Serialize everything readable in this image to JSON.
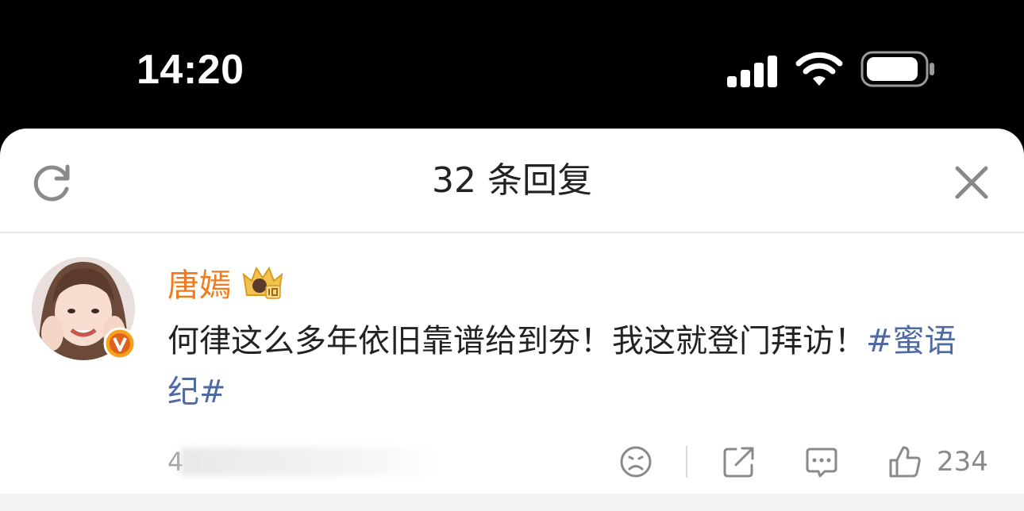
{
  "status_bar": {
    "time": "14:20",
    "icons": [
      "cellular-signal-icon",
      "wifi-icon",
      "battery-icon"
    ],
    "text_color": "#ffffff",
    "background": "#000000"
  },
  "sheet": {
    "title": "32 条回复",
    "refresh_icon": "refresh-icon",
    "close_icon": "close-icon"
  },
  "comment": {
    "username": "唐嫣",
    "username_color": "#f07a1e",
    "badges": [
      "crown-level-badge-icon",
      "verified-v-badge-icon"
    ],
    "text": "何律这么多年依旧靠谱给到夯！我这就登门拜访！",
    "topic": "#蜜语纪#",
    "topic_color": "#4f6aa3",
    "time": "4",
    "actions": {
      "icons": [
        "sad-face-icon",
        "share-icon",
        "comment-icon",
        "like-icon"
      ],
      "like_count": "234"
    }
  }
}
